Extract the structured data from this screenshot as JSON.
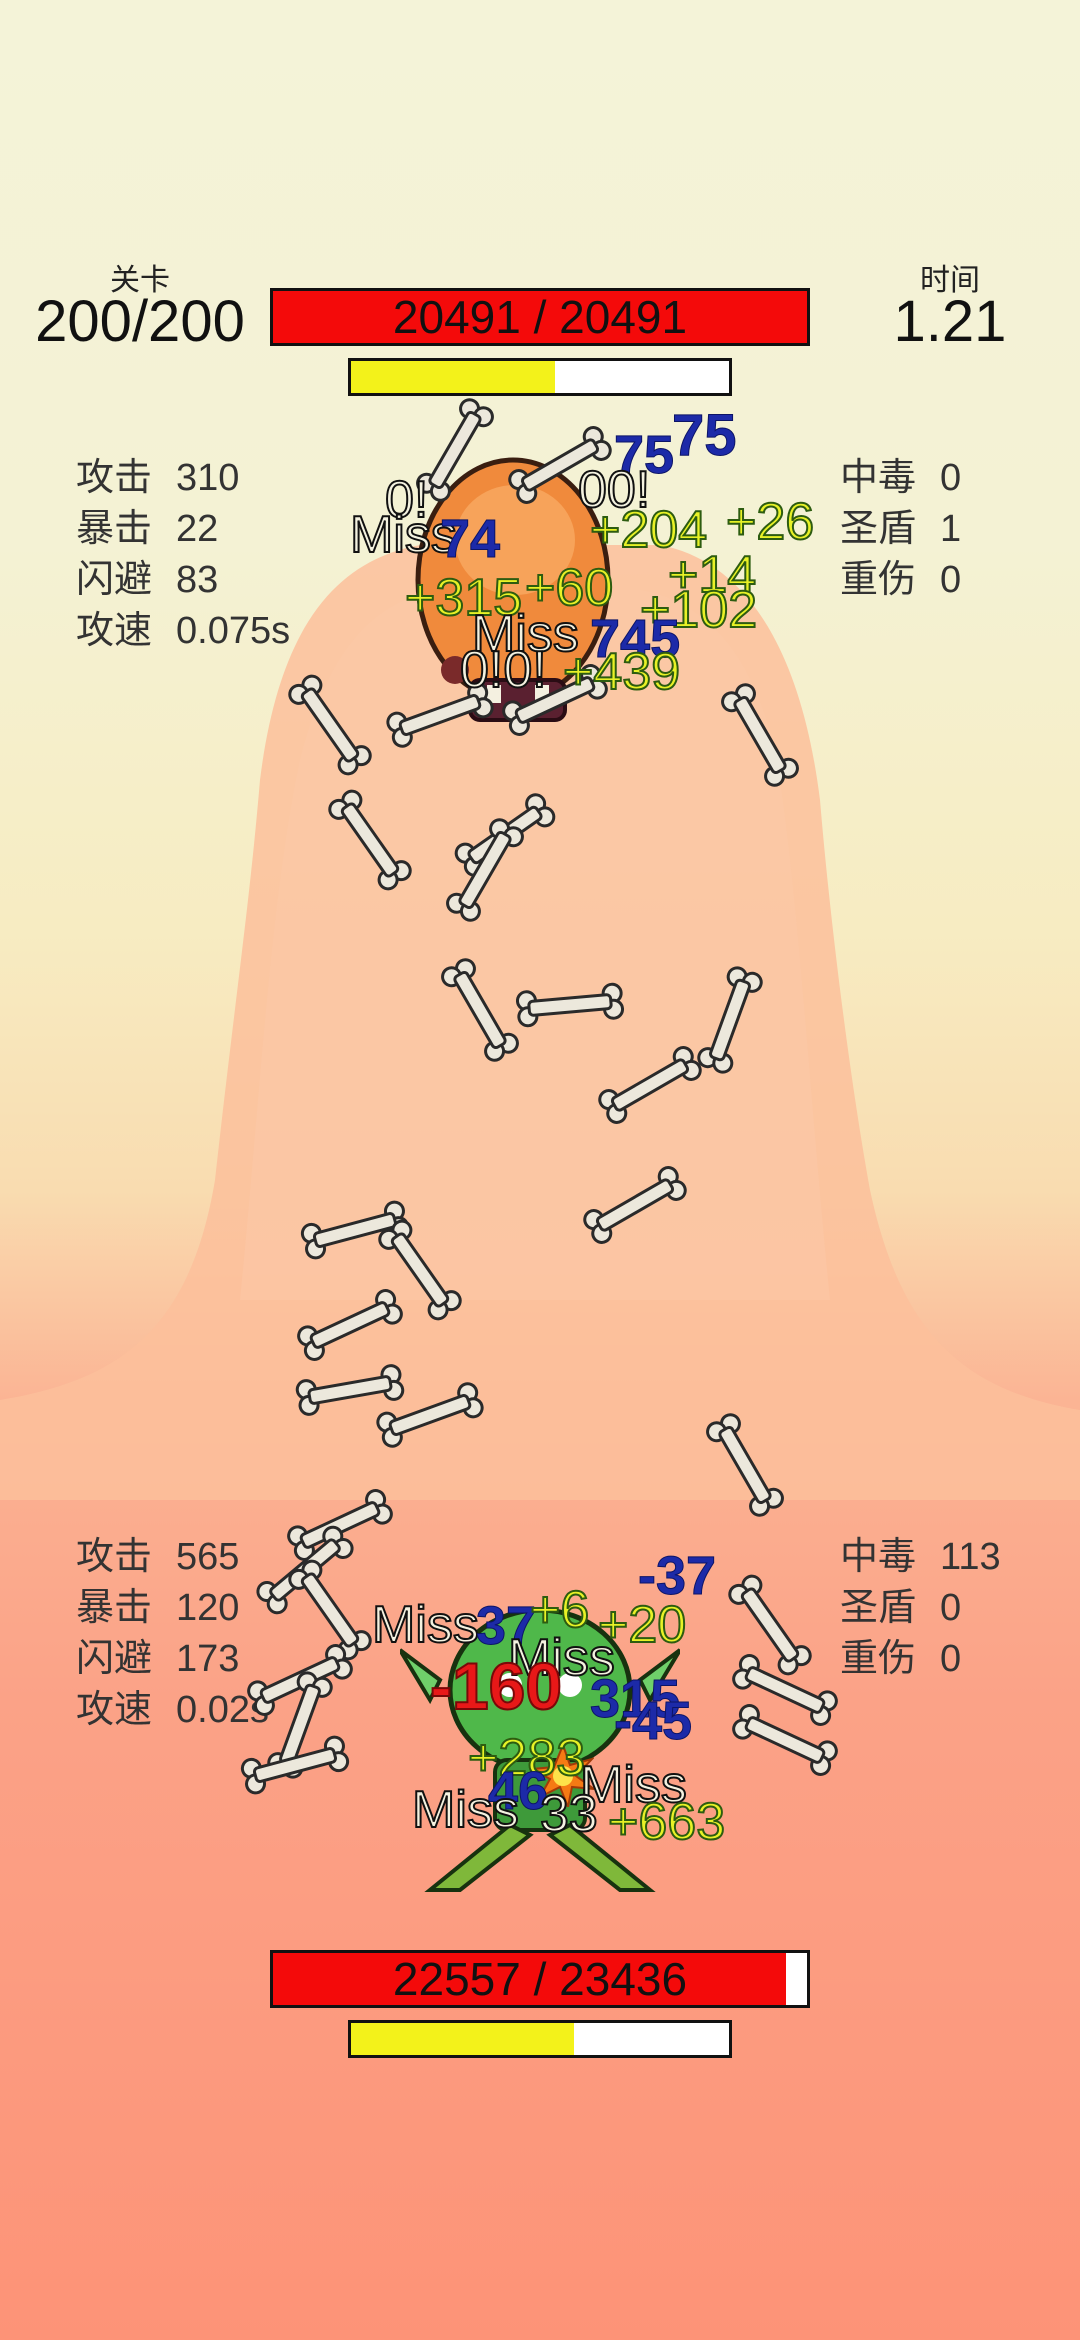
{
  "level": {
    "label": "关卡",
    "value": "200/200"
  },
  "time": {
    "label": "时间",
    "value": "1.21"
  },
  "enemy": {
    "hp_text": "20491 / 20491",
    "hp_fraction": 1.0,
    "energy_fraction": 0.54,
    "stats_left": [
      {
        "label": "攻击",
        "value": "310"
      },
      {
        "label": "暴击",
        "value": "22"
      },
      {
        "label": "闪避",
        "value": "83"
      },
      {
        "label": "攻速",
        "value": "0.075s"
      }
    ],
    "stats_right": [
      {
        "label": "中毒",
        "value": "0"
      },
      {
        "label": "圣盾",
        "value": "1"
      },
      {
        "label": "重伤",
        "value": "0"
      }
    ]
  },
  "player": {
    "hp_text": "22557 / 23436",
    "hp_fraction": 0.96,
    "energy_fraction": 0.59,
    "stats_left": [
      {
        "label": "攻击",
        "value": "565"
      },
      {
        "label": "暴击",
        "value": "120"
      },
      {
        "label": "闪避",
        "value": "173"
      },
      {
        "label": "攻速",
        "value": "0.02s"
      }
    ],
    "stats_right": [
      {
        "label": "中毒",
        "value": "113"
      },
      {
        "label": "圣盾",
        "value": "0"
      },
      {
        "label": "重伤",
        "value": "0"
      }
    ]
  },
  "floating_texts_top": [
    "75",
    "75",
    "0!",
    "00!",
    "Miss",
    "+204",
    "+26",
    "74",
    "+14",
    "+315",
    "+60",
    "+102",
    "Miss",
    "745",
    "0!0!",
    "+439"
  ],
  "floating_texts_bottom": [
    "-37",
    "Miss",
    "37",
    "+6",
    "+20",
    "Miss",
    "-160",
    "315",
    "-45",
    "+283",
    "46",
    "Miss",
    "Miss",
    "33",
    "+663"
  ],
  "colors": {
    "hp_red": "#f40a0a",
    "energy_yellow": "#f3f21a",
    "damage_yellow": "#e8f226",
    "damage_blue": "#1c2aa8",
    "damage_red": "#e81818"
  },
  "icons": {
    "enemy": "orange-beast-sprite",
    "player": "green-goblin-sprite",
    "projectile": "bone-icon",
    "hit": "explosion-icon"
  }
}
